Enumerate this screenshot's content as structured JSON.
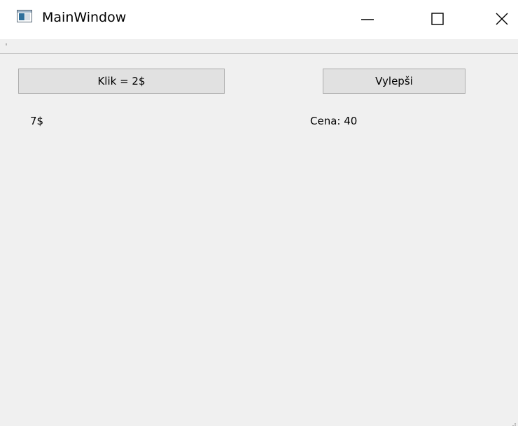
{
  "window": {
    "title": "MainWindow",
    "icon": "app-window-icon"
  },
  "controls": {
    "minimize_icon": "minimize-icon",
    "maximize_icon": "maximize-icon",
    "close_icon": "close-icon"
  },
  "main": {
    "click_button_label": "Klik = 2$",
    "upgrade_button_label": "Vylepši",
    "money_label": "7$",
    "price_label": "Cena: 40"
  }
}
